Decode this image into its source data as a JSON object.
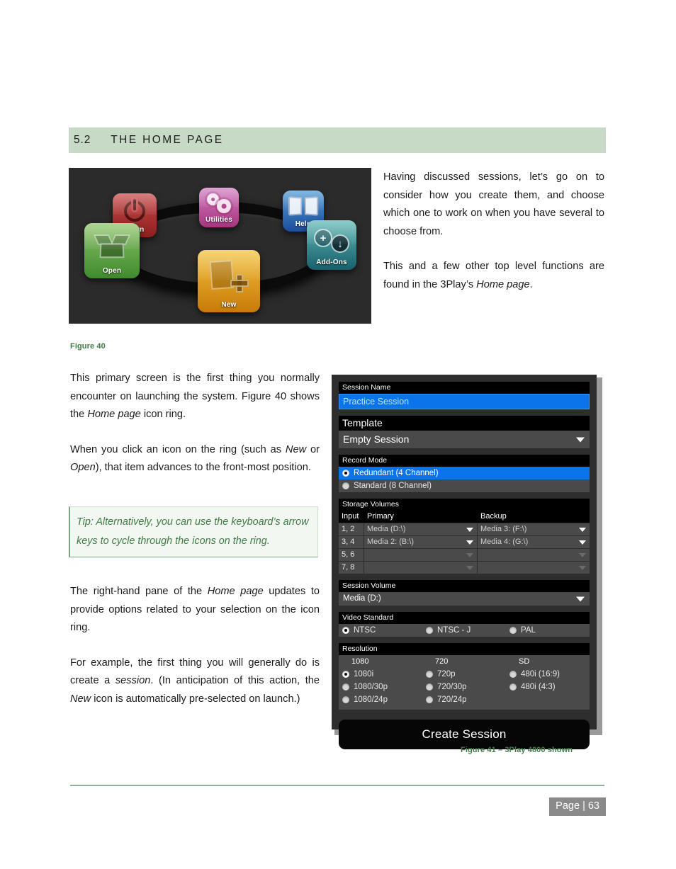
{
  "section": {
    "number": "5.2",
    "title": "THE HOME PAGE",
    "band_color": "#c6dac6"
  },
  "figure40": {
    "caption": "Figure 40",
    "background": "#2b2b2b",
    "icons": [
      {
        "name": "shutdown",
        "label": "down",
        "full_label": "Shutdown",
        "color": "#c64a4a"
      },
      {
        "name": "open",
        "label": "Open",
        "color": "#6fb348"
      },
      {
        "name": "utilities",
        "label": "Utilities",
        "color": "#c05ba8"
      },
      {
        "name": "help",
        "label": "Help",
        "color": "#3a7fc6"
      },
      {
        "name": "addons",
        "label": "Add-Ons",
        "color": "#3f96a0"
      },
      {
        "name": "new",
        "label": "New",
        "color": "#e3a81e"
      }
    ]
  },
  "figure41": {
    "caption": "Figure 41 – 3Play 4800 shown",
    "panel": {
      "session_name": {
        "header": "Session Name",
        "value": "Practice Session",
        "highlight_color": "#0b74e8"
      },
      "template": {
        "header": "Template",
        "value": "Empty Session"
      },
      "record_mode": {
        "header": "Record Mode",
        "options": [
          {
            "label": "Redundant (4 Channel)",
            "selected": true
          },
          {
            "label": "Standard (8 Channel)",
            "selected": false
          }
        ]
      },
      "storage_volumes": {
        "header": "Storage Volumes",
        "columns": [
          "Input",
          "Primary",
          "Backup"
        ],
        "rows": [
          {
            "input": "1, 2",
            "primary": "Media (D:\\)",
            "backup": "Media 3: (F:\\)",
            "enabled": true
          },
          {
            "input": "3, 4",
            "primary": "Media 2: (B:\\)",
            "backup": "Media 4: (G:\\)",
            "enabled": true
          },
          {
            "input": "5, 6",
            "primary": "",
            "backup": "",
            "enabled": false
          },
          {
            "input": "7, 8",
            "primary": "",
            "backup": "",
            "enabled": false
          }
        ]
      },
      "session_volume": {
        "header": "Session Volume",
        "value": "Media (D:)"
      },
      "video_standard": {
        "header": "Video Standard",
        "options": [
          {
            "label": "NTSC",
            "selected": true
          },
          {
            "label": "NTSC - J",
            "selected": false
          },
          {
            "label": "PAL",
            "selected": false
          }
        ]
      },
      "resolution": {
        "header": "Resolution",
        "groups": [
          {
            "title": "1080",
            "options": [
              {
                "label": "1080i",
                "selected": true
              },
              {
                "label": "1080/30p",
                "selected": false
              },
              {
                "label": "1080/24p",
                "selected": false
              }
            ]
          },
          {
            "title": "720",
            "options": [
              {
                "label": "720p",
                "selected": false
              },
              {
                "label": "720/30p",
                "selected": false
              },
              {
                "label": "720/24p",
                "selected": false
              }
            ]
          },
          {
            "title": "SD",
            "options": [
              {
                "label": "480i (16:9)",
                "selected": false
              },
              {
                "label": "480i (4:3)",
                "selected": false
              }
            ]
          }
        ]
      },
      "create_button": "Create Session"
    }
  },
  "body": {
    "top_right": {
      "p1": "Having discussed sessions, let’s go on to consider how you create them, and choose which one to work on when you have several to choose from.",
      "p2_before": "This and a few other top level functions are found in the 3Play’s ",
      "p2_italic": "Home page",
      "p2_after": "."
    },
    "left_a": {
      "p1_before": "This primary screen is the first thing you normally encounter on launching the system. Figure 40 shows the ",
      "p1_italic": "Home page",
      "p1_after": " icon ring.",
      "p2_before": "When you click an icon on the ring (such as ",
      "p2_italic1": "New",
      "p2_mid": " or ",
      "p2_italic2": "Open",
      "p2_after": "), that item advances to the front-most position."
    },
    "tip": "Tip: Alternatively, you can use the keyboard’s arrow keys to cycle through the icons on the ring.",
    "left_b": {
      "p1_before": "The right-hand pane of the ",
      "p1_italic": "Home page",
      "p1_after": " updates to provide options related to your selection on the icon ring.",
      "p2_before": "For example, the first thing you will generally do is create a ",
      "p2_italic1": "session",
      "p2_mid": ". (In anticipation of this action, the ",
      "p2_italic2": "New",
      "p2_after": " icon is automatically pre-selected on launch.)"
    }
  },
  "footer": {
    "page_label": "Page  |  63",
    "rule_color": "#8fb496"
  }
}
